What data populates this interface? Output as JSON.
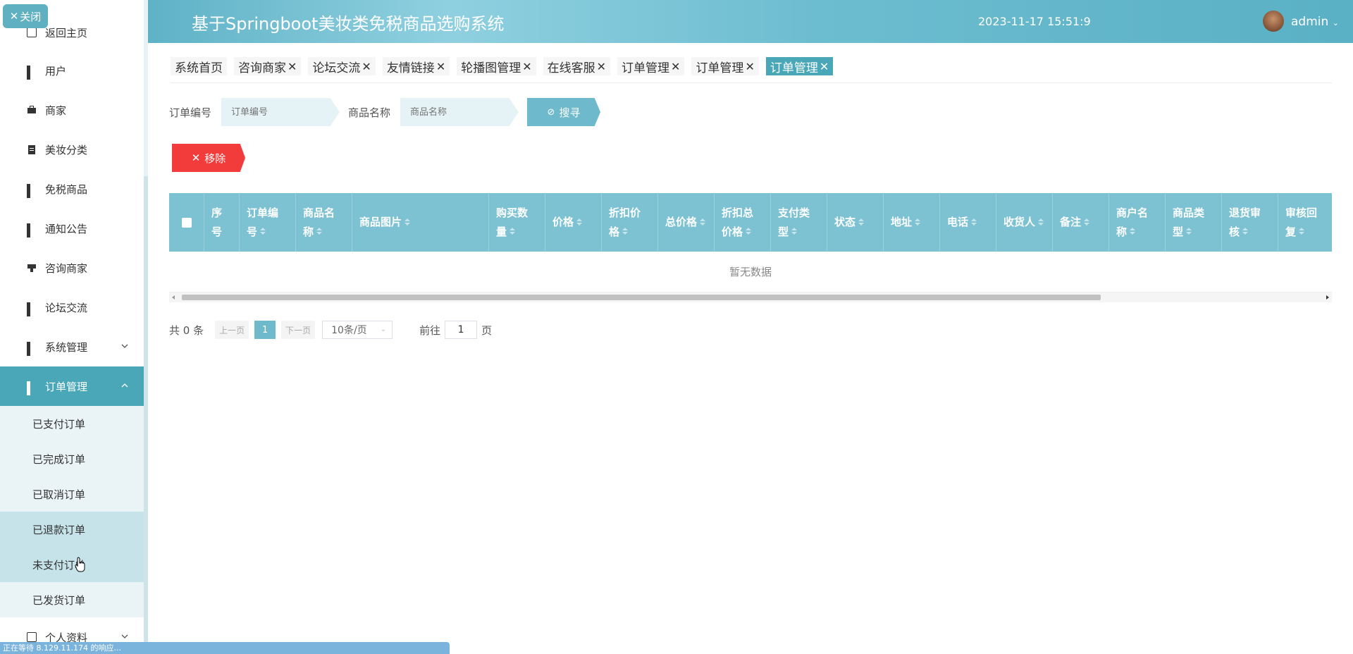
{
  "app": {
    "title": "基于Springboot美妆类免税商品选购系统",
    "datetime": "2023-11-17 15:51:9",
    "user": "admin",
    "close_label": "关闭"
  },
  "sidebar": {
    "partial_top": "返回主页",
    "items": [
      {
        "label": "用户",
        "icon": "grid-icon"
      },
      {
        "label": "商家",
        "icon": "briefcase-icon"
      },
      {
        "label": "美妆分类",
        "icon": "clipboard-icon"
      },
      {
        "label": "免税商品",
        "icon": "grid-icon"
      },
      {
        "label": "通知公告",
        "icon": "grid-icon"
      },
      {
        "label": "咨询商家",
        "icon": "chat-icon"
      },
      {
        "label": "论坛交流",
        "icon": "grid-icon"
      },
      {
        "label": "系统管理",
        "icon": "grid-icon"
      },
      {
        "label": "订单管理",
        "icon": "grid-icon"
      }
    ],
    "submenu": [
      "已支付订单",
      "已完成订单",
      "已取消订单",
      "已退款订单",
      "未支付订单",
      "已发货订单"
    ],
    "partial_bottom": "个人资料"
  },
  "tabs": [
    {
      "label": "系统首页",
      "closable": false
    },
    {
      "label": "咨询商家",
      "closable": true
    },
    {
      "label": "论坛交流",
      "closable": true
    },
    {
      "label": "友情链接",
      "closable": true
    },
    {
      "label": "轮播图管理",
      "closable": true
    },
    {
      "label": "在线客服",
      "closable": true
    },
    {
      "label": "订单管理",
      "closable": true
    },
    {
      "label": "订单管理",
      "closable": true
    },
    {
      "label": "订单管理",
      "closable": true,
      "active": true
    }
  ],
  "search": {
    "order_no_label": "订单编号",
    "order_no_placeholder": "订单编号",
    "goods_name_label": "商品名称",
    "goods_name_placeholder": "商品名称",
    "search_button": "搜寻"
  },
  "actions": {
    "remove_button": "移除"
  },
  "table": {
    "columns": [
      {
        "l1": "序",
        "l2": "号",
        "sortable": false
      },
      {
        "l1": "订单编",
        "l2": "号",
        "sortable": true
      },
      {
        "l1": "商品名",
        "l2": "称",
        "sortable": true
      },
      {
        "l1": "商品图片",
        "l2": "",
        "sortable": true
      },
      {
        "l1": "购买数",
        "l2": "量",
        "sortable": true
      },
      {
        "l1": "价格",
        "l2": "",
        "sortable": true
      },
      {
        "l1": "折扣价",
        "l2": "格",
        "sortable": true
      },
      {
        "l1": "总价格",
        "l2": "",
        "sortable": true
      },
      {
        "l1": "折扣总",
        "l2": "价格",
        "sortable": true
      },
      {
        "l1": "支付类",
        "l2": "型",
        "sortable": true
      },
      {
        "l1": "状态",
        "l2": "",
        "sortable": true
      },
      {
        "l1": "地址",
        "l2": "",
        "sortable": true
      },
      {
        "l1": "电话",
        "l2": "",
        "sortable": true
      },
      {
        "l1": "收货人",
        "l2": "",
        "sortable": true
      },
      {
        "l1": "备注",
        "l2": "",
        "sortable": true
      },
      {
        "l1": "商户名",
        "l2": "称",
        "sortable": true
      },
      {
        "l1": "商品类",
        "l2": "型",
        "sortable": true
      },
      {
        "l1": "退货审",
        "l2": "核",
        "sortable": true
      },
      {
        "l1": "审核回",
        "l2": "复",
        "sortable": true
      }
    ],
    "empty_text": "暂无数据"
  },
  "pagination": {
    "total": "共 0 条",
    "prev": "上一页",
    "current": "1",
    "next": "下一页",
    "page_size": "10条/页",
    "goto_label": "前往",
    "goto_value": "1",
    "page_suffix": "页"
  },
  "status_bar": "正在等待 8.129.11.174 的响应..."
}
